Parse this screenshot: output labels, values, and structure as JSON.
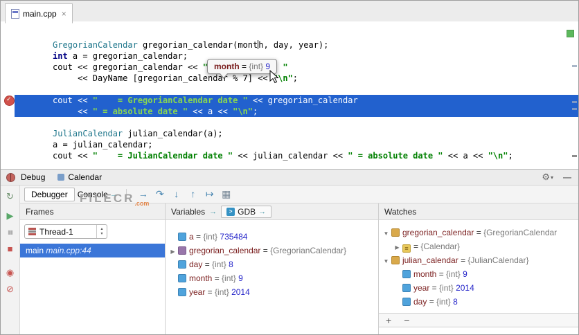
{
  "ui_icons": {
    "gear": "⚙",
    "gear_caret": "▾",
    "hide": "—",
    "combo_up": "▴",
    "combo_down": "▾",
    "expand": "▶",
    "collapse": "▼",
    "console_arrow": "→",
    "variables_arrow": "→",
    "gdb_prompt": ">",
    "close": "×"
  },
  "tabbar": {
    "tabs": [
      {
        "label": "main.cpp"
      }
    ]
  },
  "editor": {
    "tooltip": {
      "name": "month",
      "eq": " = ",
      "type": "{int}",
      "value": "9"
    },
    "lines": [
      {
        "segs": [
          {
            "t": "GregorianCalendar",
            "c": "cls"
          },
          {
            "t": " gregorian_calendar(mont",
            "c": "pl"
          },
          {
            "caret": true
          },
          {
            "t": "h, day, year);",
            "c": "pl"
          }
        ]
      },
      {
        "segs": [
          {
            "t": "int",
            "c": "kw"
          },
          {
            "t": " a = gregorian_calendar;",
            "c": "pl"
          }
        ]
      },
      {
        "segs": [
          {
            "t": "cout << gregorian_calendar << ",
            "c": "pl"
          },
          {
            "t": "\"               \"",
            "c": "str"
          }
        ]
      },
      {
        "segs": [
          {
            "t": "     << DayName [gregorian_calendar % 7] << ",
            "c": "pl"
          },
          {
            "t": "\"\\n\"",
            "c": "str"
          },
          {
            "t": ";",
            "c": "pl"
          }
        ]
      },
      {
        "segs": []
      },
      {
        "exec": true,
        "segs": [
          {
            "t": "cout << ",
            "c": "pl"
          },
          {
            "t": "\"    = GregorianCalendar date \"",
            "c": "str"
          },
          {
            "t": " << gregorian_calendar",
            "c": "pl"
          }
        ]
      },
      {
        "exec": true,
        "segs": [
          {
            "t": "     << ",
            "c": "pl"
          },
          {
            "t": "\" = absolute date \"",
            "c": "str"
          },
          {
            "t": " << a << ",
            "c": "pl"
          },
          {
            "t": "\"\\n\"",
            "c": "str"
          },
          {
            "t": ";",
            "c": "pl"
          }
        ]
      },
      {
        "segs": []
      },
      {
        "segs": [
          {
            "t": "JulianCalendar",
            "c": "cls"
          },
          {
            "t": " julian_calendar(a);",
            "c": "pl"
          }
        ]
      },
      {
        "segs": [
          {
            "t": "a = julian_calendar;",
            "c": "pl"
          }
        ]
      },
      {
        "segs": [
          {
            "t": "cout << ",
            "c": "pl"
          },
          {
            "t": "\"    = JulianCalendar date \"",
            "c": "str"
          },
          {
            "t": " << julian_calendar << ",
            "c": "pl"
          },
          {
            "t": "\" = absolute date \"",
            "c": "str"
          },
          {
            "t": " << a << ",
            "c": "pl"
          },
          {
            "t": "\"\\n\"",
            "c": "str"
          },
          {
            "t": ";",
            "c": "pl"
          }
        ]
      }
    ]
  },
  "debug": {
    "title": "Debug",
    "session_tab": "Calendar",
    "debugger_tab": "Debugger",
    "console_tab": "Console",
    "step_icons": [
      {
        "name": "show-execution-point-icon",
        "glyph": "→",
        "color": "#4584B0"
      },
      {
        "name": "step-over-icon",
        "glyph": "↷",
        "color": "#4584B0"
      },
      {
        "name": "step-into-icon",
        "glyph": "↓",
        "color": "#4584B0"
      },
      {
        "name": "step-out-icon",
        "glyph": "↑",
        "color": "#4584B0"
      },
      {
        "name": "run-to-cursor-icon",
        "glyph": "↦",
        "color": "#4584B0"
      },
      {
        "name": "evaluate-expression-icon",
        "glyph": "▦",
        "color": "#7A8A99"
      }
    ],
    "side_icons": [
      {
        "name": "rerun-icon",
        "glyph": "↻",
        "color": "#6C8F6C"
      },
      {
        "name": "resume-icon",
        "glyph": "▶",
        "color": "#59A869"
      },
      {
        "name": "pause-icon",
        "glyph": "▮▮",
        "color": "#B0B0B0"
      },
      {
        "name": "stop-icon",
        "glyph": "■",
        "color": "#C75450"
      },
      {
        "name": "view-breakpoints-icon",
        "glyph": "◉",
        "color": "#C75450"
      },
      {
        "name": "mute-breakpoints-icon",
        "glyph": "⊘",
        "color": "#C75450"
      }
    ],
    "frames": {
      "title": "Frames",
      "thread_label": "Thread-1",
      "frame": {
        "fn": "main",
        "loc": "main.cpp:44"
      }
    },
    "variables": {
      "title": "Variables",
      "gdb_tab": "GDB",
      "rows": [
        {
          "expand": "",
          "icon": "primitive",
          "name": "a",
          "type": "{int}",
          "value": "735484"
        },
        {
          "expand": "collapsed",
          "icon": "object",
          "name": "gregorian_calendar",
          "type": "{GregorianCalendar}",
          "value": ""
        },
        {
          "expand": "",
          "icon": "primitive",
          "name": "day",
          "type": "{int}",
          "value": "8"
        },
        {
          "expand": "",
          "icon": "primitive",
          "name": "month",
          "type": "{int}",
          "value": "9"
        },
        {
          "expand": "",
          "icon": "primitive",
          "name": "year",
          "type": "{int}",
          "value": "2014"
        }
      ]
    },
    "watches": {
      "title": "Watches",
      "rows": [
        {
          "indent": 0,
          "expand": "expanded",
          "icon": "watch",
          "name": "gregorian_calendar",
          "type": "{GregorianCalendar",
          "value": ""
        },
        {
          "indent": 1,
          "expand": "collapsed",
          "icon": "base",
          "name": "",
          "type": "{Calendar}",
          "value": ""
        },
        {
          "indent": 0,
          "expand": "expanded",
          "icon": "watch",
          "name": "julian_calendar",
          "type": "{JulianCalendar}",
          "value": ""
        },
        {
          "indent": 1,
          "expand": "",
          "icon": "primitive",
          "name": "month",
          "type": "{int}",
          "value": "9"
        },
        {
          "indent": 1,
          "expand": "",
          "icon": "primitive",
          "name": "year",
          "type": "{int}",
          "value": "2014"
        },
        {
          "indent": 1,
          "expand": "",
          "icon": "primitive",
          "name": "day",
          "type": "{int}",
          "value": "8"
        }
      ],
      "add_label": "+",
      "remove_label": "−"
    }
  },
  "watermark": {
    "text": "FILECR",
    "suffix": ".com"
  }
}
